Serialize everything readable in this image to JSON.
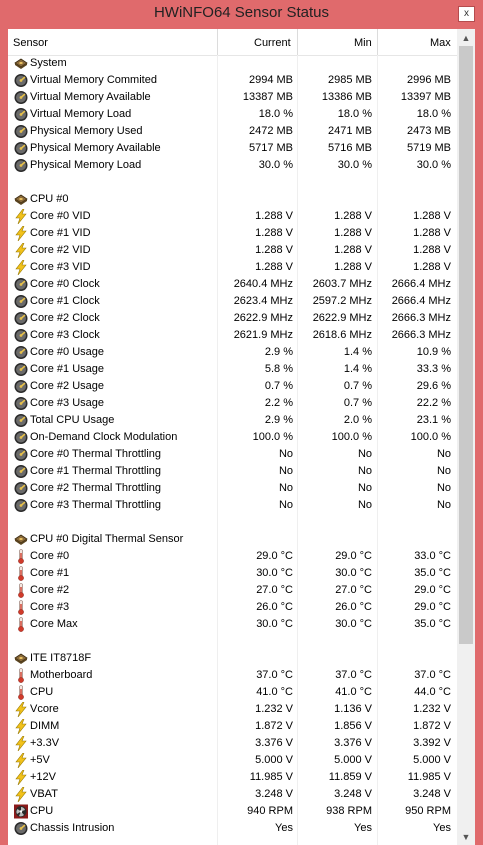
{
  "window": {
    "title": "HWiNFO64 Sensor Status",
    "close_glyph": "x"
  },
  "columns": {
    "sensor": "Sensor",
    "current": "Current",
    "min": "Min",
    "max": "Max"
  },
  "scrollbar": {
    "up_glyph": "▲",
    "down_glyph": "▼"
  },
  "rows": [
    {
      "type": "group",
      "icon": "chip-icon",
      "name": "System"
    },
    {
      "type": "item",
      "icon": "gauge-icon",
      "name": "Virtual Memory Commited",
      "cur": "2994 MB",
      "min": "2985 MB",
      "max": "2996 MB"
    },
    {
      "type": "item",
      "icon": "gauge-icon",
      "name": "Virtual Memory Available",
      "cur": "13387 MB",
      "min": "13386 MB",
      "max": "13397 MB"
    },
    {
      "type": "item",
      "icon": "gauge-icon",
      "name": "Virtual Memory Load",
      "cur": "18.0 %",
      "min": "18.0 %",
      "max": "18.0 %"
    },
    {
      "type": "item",
      "icon": "gauge-icon",
      "name": "Physical Memory Used",
      "cur": "2472 MB",
      "min": "2471 MB",
      "max": "2473 MB"
    },
    {
      "type": "item",
      "icon": "gauge-icon",
      "name": "Physical Memory Available",
      "cur": "5717 MB",
      "min": "5716 MB",
      "max": "5719 MB"
    },
    {
      "type": "item",
      "icon": "gauge-icon",
      "name": "Physical Memory Load",
      "cur": "30.0 %",
      "min": "30.0 %",
      "max": "30.0 %"
    },
    {
      "type": "blank"
    },
    {
      "type": "group",
      "icon": "chip-icon",
      "name": "CPU #0"
    },
    {
      "type": "item",
      "icon": "bolt-icon",
      "name": "Core #0 VID",
      "cur": "1.288 V",
      "min": "1.288 V",
      "max": "1.288 V"
    },
    {
      "type": "item",
      "icon": "bolt-icon",
      "name": "Core #1 VID",
      "cur": "1.288 V",
      "min": "1.288 V",
      "max": "1.288 V"
    },
    {
      "type": "item",
      "icon": "bolt-icon",
      "name": "Core #2 VID",
      "cur": "1.288 V",
      "min": "1.288 V",
      "max": "1.288 V"
    },
    {
      "type": "item",
      "icon": "bolt-icon",
      "name": "Core #3 VID",
      "cur": "1.288 V",
      "min": "1.288 V",
      "max": "1.288 V"
    },
    {
      "type": "item",
      "icon": "gauge-icon",
      "name": "Core #0 Clock",
      "cur": "2640.4 MHz",
      "min": "2603.7 MHz",
      "max": "2666.4 MHz"
    },
    {
      "type": "item",
      "icon": "gauge-icon",
      "name": "Core #1 Clock",
      "cur": "2623.4 MHz",
      "min": "2597.2 MHz",
      "max": "2666.4 MHz"
    },
    {
      "type": "item",
      "icon": "gauge-icon",
      "name": "Core #2 Clock",
      "cur": "2622.9 MHz",
      "min": "2622.9 MHz",
      "max": "2666.3 MHz"
    },
    {
      "type": "item",
      "icon": "gauge-icon",
      "name": "Core #3 Clock",
      "cur": "2621.9 MHz",
      "min": "2618.6 MHz",
      "max": "2666.3 MHz"
    },
    {
      "type": "item",
      "icon": "gauge-icon",
      "name": "Core #0 Usage",
      "cur": "2.9 %",
      "min": "1.4 %",
      "max": "10.9 %"
    },
    {
      "type": "item",
      "icon": "gauge-icon",
      "name": "Core #1 Usage",
      "cur": "5.8 %",
      "min": "1.4 %",
      "max": "33.3 %"
    },
    {
      "type": "item",
      "icon": "gauge-icon",
      "name": "Core #2 Usage",
      "cur": "0.7 %",
      "min": "0.7 %",
      "max": "29.6 %"
    },
    {
      "type": "item",
      "icon": "gauge-icon",
      "name": "Core #3 Usage",
      "cur": "2.2 %",
      "min": "0.7 %",
      "max": "22.2 %"
    },
    {
      "type": "item",
      "icon": "gauge-icon",
      "name": "Total CPU Usage",
      "cur": "2.9 %",
      "min": "2.0 %",
      "max": "23.1 %"
    },
    {
      "type": "item",
      "icon": "gauge-icon",
      "name": "On-Demand Clock Modulation",
      "cur": "100.0 %",
      "min": "100.0 %",
      "max": "100.0 %"
    },
    {
      "type": "item",
      "icon": "gauge-icon",
      "name": "Core #0 Thermal Throttling",
      "cur": "No",
      "min": "No",
      "max": "No"
    },
    {
      "type": "item",
      "icon": "gauge-icon",
      "name": "Core #1 Thermal Throttling",
      "cur": "No",
      "min": "No",
      "max": "No"
    },
    {
      "type": "item",
      "icon": "gauge-icon",
      "name": "Core #2 Thermal Throttling",
      "cur": "No",
      "min": "No",
      "max": "No"
    },
    {
      "type": "item",
      "icon": "gauge-icon",
      "name": "Core #3 Thermal Throttling",
      "cur": "No",
      "min": "No",
      "max": "No"
    },
    {
      "type": "blank"
    },
    {
      "type": "group",
      "icon": "chip-icon",
      "name": "CPU #0 Digital Thermal Sensor"
    },
    {
      "type": "item",
      "icon": "thermometer-icon",
      "name": "Core #0",
      "cur": "29.0 °C",
      "min": "29.0 °C",
      "max": "33.0 °C"
    },
    {
      "type": "item",
      "icon": "thermometer-icon",
      "name": "Core #1",
      "cur": "30.0 °C",
      "min": "30.0 °C",
      "max": "35.0 °C"
    },
    {
      "type": "item",
      "icon": "thermometer-icon",
      "name": "Core #2",
      "cur": "27.0 °C",
      "min": "27.0 °C",
      "max": "29.0 °C"
    },
    {
      "type": "item",
      "icon": "thermometer-icon",
      "name": "Core #3",
      "cur": "26.0 °C",
      "min": "26.0 °C",
      "max": "29.0 °C"
    },
    {
      "type": "item",
      "icon": "thermometer-icon",
      "name": "Core Max",
      "cur": "30.0 °C",
      "min": "30.0 °C",
      "max": "35.0 °C"
    },
    {
      "type": "blank"
    },
    {
      "type": "group",
      "icon": "chip-icon",
      "name": "ITE IT8718F"
    },
    {
      "type": "item",
      "icon": "thermometer-icon",
      "name": "Motherboard",
      "cur": "37.0 °C",
      "min": "37.0 °C",
      "max": "37.0 °C"
    },
    {
      "type": "item",
      "icon": "thermometer-icon",
      "name": "CPU",
      "cur": "41.0 °C",
      "min": "41.0 °C",
      "max": "44.0 °C"
    },
    {
      "type": "item",
      "icon": "bolt-icon",
      "name": "Vcore",
      "cur": "1.232 V",
      "min": "1.136 V",
      "max": "1.232 V"
    },
    {
      "type": "item",
      "icon": "bolt-icon",
      "name": "DIMM",
      "cur": "1.872 V",
      "min": "1.856 V",
      "max": "1.872 V"
    },
    {
      "type": "item",
      "icon": "bolt-icon",
      "name": "+3.3V",
      "cur": "3.376 V",
      "min": "3.376 V",
      "max": "3.392 V"
    },
    {
      "type": "item",
      "icon": "bolt-icon",
      "name": "+5V",
      "cur": "5.000 V",
      "min": "5.000 V",
      "max": "5.000 V"
    },
    {
      "type": "item",
      "icon": "bolt-icon",
      "name": "+12V",
      "cur": "11.985 V",
      "min": "11.859 V",
      "max": "11.985 V"
    },
    {
      "type": "item",
      "icon": "bolt-icon",
      "name": "VBAT",
      "cur": "3.248 V",
      "min": "3.248 V",
      "max": "3.248 V"
    },
    {
      "type": "item",
      "icon": "fan-icon",
      "name": "CPU",
      "cur": "940 RPM",
      "min": "938 RPM",
      "max": "950 RPM"
    },
    {
      "type": "item",
      "icon": "gauge-icon",
      "name": "Chassis Intrusion",
      "cur": "Yes",
      "min": "Yes",
      "max": "Yes"
    }
  ]
}
